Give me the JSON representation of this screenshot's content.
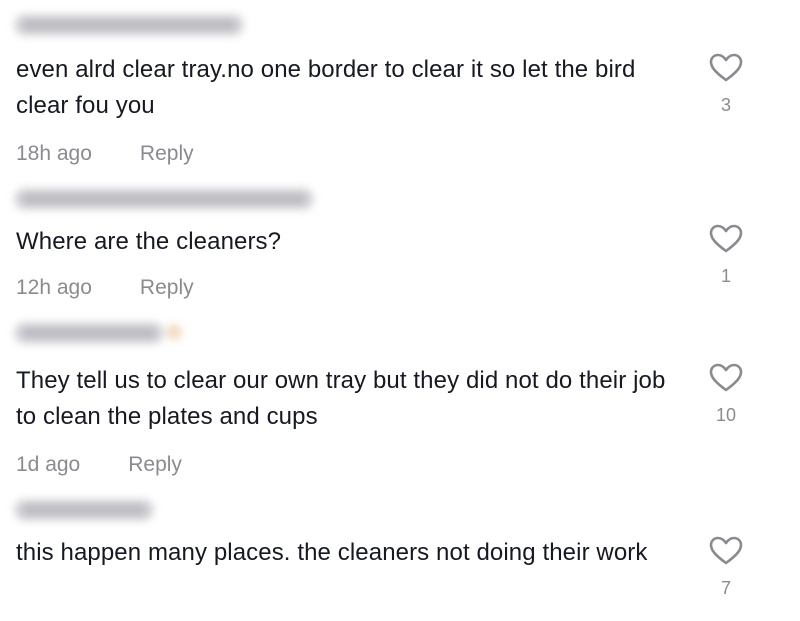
{
  "comments": [
    {
      "text": "even alrd clear tray.no one border to clear it so let the bird clear fou you",
      "time": "18h ago",
      "reply_label": "Reply",
      "likes": "3",
      "like_icon": "heart-outline-icon"
    },
    {
      "text": "Where are the cleaners?",
      "time": "12h ago",
      "reply_label": "Reply",
      "likes": "1",
      "like_icon": "heart-outline-icon"
    },
    {
      "text": "They tell us to clear our own tray but they did not do their job to clean the plates and cups",
      "time": "1d ago",
      "reply_label": "Reply",
      "likes": "10",
      "like_icon": "heart-outline-icon"
    },
    {
      "text": "this happen many places. the cleaners not doing their work",
      "likes": "7",
      "like_icon": "heart-outline-icon"
    }
  ],
  "colors": {
    "text": "#161823",
    "muted": "#8a8b91",
    "icon": "#8a8b91"
  }
}
